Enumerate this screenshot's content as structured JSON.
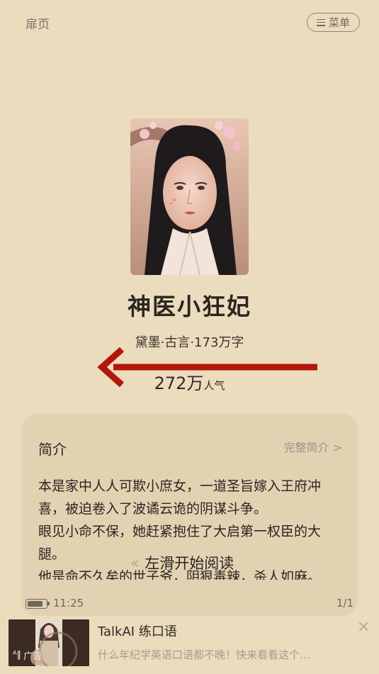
{
  "header": {
    "back_label": "扉页",
    "menu_label": "菜单"
  },
  "book": {
    "title": "神医小狂妃",
    "meta": "黛墨·古言·173万字",
    "popularity_value": "272万",
    "popularity_unit": "人气"
  },
  "intro": {
    "heading": "简介",
    "full_link": "完整简介 >",
    "paragraphs": [
      "本是家中人人可欺小庶女，一道圣旨嫁入王府冲喜，被迫卷入了波谲云诡的阴谋斗争。",
      "眼见小命不保，她赶紧抱住了大启第一权臣的大腿。",
      "他是命不久矣的世子爷，阴狠毒辣，杀人如麻。"
    ]
  },
  "swipe_hint": "左滑开始阅读",
  "status": {
    "time": "11:25",
    "page": "1/1",
    "battery_level": 0.85
  },
  "ad": {
    "label": "广告",
    "title": "TalkAI 练口语",
    "description": "什么年纪学英语口语都不晚！快来看看这个…",
    "close_glyph": "✕"
  },
  "colors": {
    "background": "#ecdcbe",
    "card": "#e3d2b2",
    "arrow": "#b5160c"
  }
}
